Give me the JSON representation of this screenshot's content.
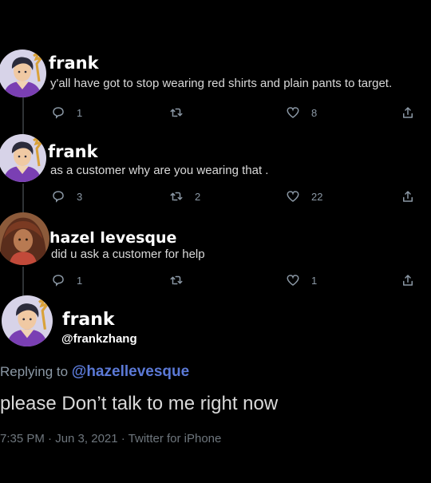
{
  "colors": {
    "background": "#000000",
    "text": "#d9d9d9",
    "name": "#ffffff",
    "muted": "#8b98a5",
    "mention": "#5b79d6",
    "thread_line": "#2f3336"
  },
  "tweets": [
    {
      "name": "frank",
      "text": "y'all have got to stop wearing red shirts and plain pants to target.",
      "reply_count": "1",
      "retweet_count": "",
      "like_count": "8",
      "avatar": "frank-avatar"
    },
    {
      "name": "frank",
      "text": "as a customer why are you wearing that .",
      "reply_count": "3",
      "retweet_count": "2",
      "like_count": "22",
      "avatar": "frank-avatar"
    },
    {
      "name": "hazel levesque",
      "text": "did u ask a customer for help",
      "reply_count": "1",
      "retweet_count": "",
      "like_count": "1",
      "avatar": "hazel-avatar"
    }
  ],
  "focus_tweet": {
    "name": "frank",
    "handle": "@frankzhang",
    "replying_label": "Replying to",
    "replying_to": "@hazellevesque",
    "text": "please Don’t talk to me right now",
    "meta": "7:35 PM · Jun 3, 2021 · Twitter for iPhone",
    "avatar": "frank-avatar"
  },
  "icons": {
    "reply": "reply-icon",
    "retweet": "retweet-icon",
    "like": "heart-icon",
    "share": "share-icon"
  }
}
